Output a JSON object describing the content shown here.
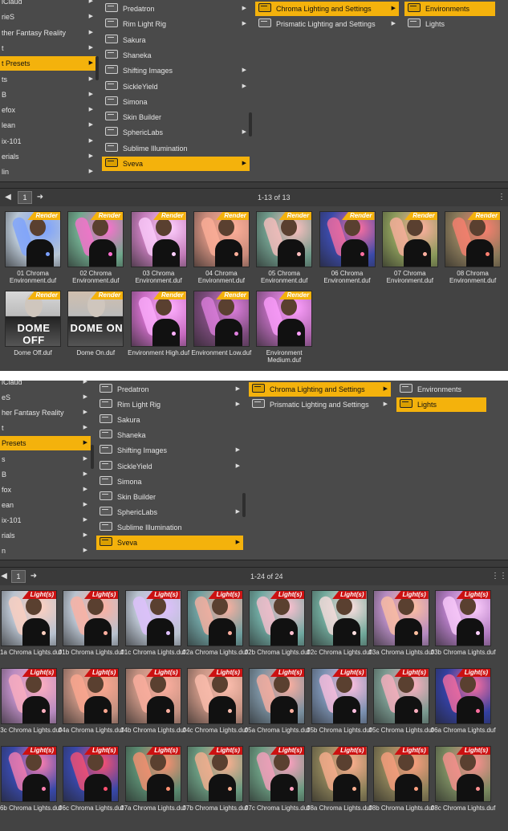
{
  "colors": {
    "accent": "#f4b20c",
    "render_badge": "#f4b20c",
    "light_badge": "#cc1111",
    "panel_bg": "#4a4a4a"
  },
  "top": {
    "col1": [
      "iClaud",
      "rieS",
      "ther Fantasy Reality",
      "t",
      "t Presets",
      "ts",
      "B",
      "efox",
      "lean",
      "ix-101",
      "erials",
      "lin"
    ],
    "col1_selected": 4,
    "col2": [
      {
        "label": "Predatron",
        "arrow": true
      },
      {
        "label": "Rim Light Rig",
        "arrow": true
      },
      {
        "label": "Sakura",
        "arrow": false
      },
      {
        "label": "Shaneka",
        "arrow": false
      },
      {
        "label": "Shifting Images",
        "arrow": true
      },
      {
        "label": "SickleYield",
        "arrow": true
      },
      {
        "label": "Simona",
        "arrow": false
      },
      {
        "label": "Skin Builder",
        "arrow": false
      },
      {
        "label": "SphericLabs",
        "arrow": true
      },
      {
        "label": "Sublime Illumination",
        "arrow": false
      },
      {
        "label": "Sveva",
        "arrow": true
      }
    ],
    "col2_selected": 10,
    "col3": [
      {
        "label": "Chroma Lighting and Settings",
        "arrow": true
      },
      {
        "label": "Prismatic Lighting and Settings",
        "arrow": true
      }
    ],
    "col3_selected": 0,
    "col4": [
      "Environments",
      "Lights"
    ],
    "col4_selected": 0,
    "page_number": "1",
    "page_count": "1-13 of 13",
    "badge_label": "Render",
    "tiles": [
      {
        "label": "01 Chroma Environment.duf",
        "hue": "#b8c6d4",
        "light": "#7aa0ff"
      },
      {
        "label": "02 Chroma Environment.duf",
        "hue": "#6fa88c",
        "light": "#ff6fd0"
      },
      {
        "label": "03 Chroma Environment.duf",
        "hue": "#c27ab8",
        "light": "#ffd0ff"
      },
      {
        "label": "04 Chroma Environment.duf",
        "hue": "#c98a7a",
        "light": "#ffb09a"
      },
      {
        "label": "05 Chroma Environment.duf",
        "hue": "#6f9a8a",
        "light": "#ffc0c0"
      },
      {
        "label": "06 Chroma Environment.duf",
        "hue": "#3b4aa8",
        "light": "#ff6fa0"
      },
      {
        "label": "07 Chroma Environment.duf",
        "hue": "#8a9a5a",
        "light": "#ffb0a0"
      },
      {
        "label": "08 Chroma Environment.duf",
        "hue": "#8a7a5a",
        "light": "#ff8070"
      },
      {
        "label": "Dome Off.duf",
        "hue": "#d8d8d8",
        "light": "#ffffff",
        "dome": "DOME OFF"
      },
      {
        "label": "Dome On.duf",
        "hue": "#d0bfae",
        "light": "#ffffff",
        "dome": "DOME ON"
      },
      {
        "label": "Environment High.duf",
        "hue": "#c66ac0",
        "light": "#ffb0ff"
      },
      {
        "label": "Environment Low.duf",
        "hue": "#7a4a7a",
        "light": "#e080e0"
      },
      {
        "label": "Environment Medium.duf",
        "hue": "#b066b0",
        "light": "#ffa0ff"
      }
    ]
  },
  "bottom": {
    "col1": [
      "iClaud",
      "eS",
      "her Fantasy Reality",
      "t",
      "Presets",
      "s",
      "B",
      "fox",
      "ean",
      "ix-101",
      "rials",
      "n"
    ],
    "col1_selected": 4,
    "col2_selected": 10,
    "col3_selected": 0,
    "col4_selected": 1,
    "page_number": "1",
    "page_count": "1-24 of 24",
    "badge_label": "Light(s)",
    "tiles": [
      {
        "label": "01a Chroma Lights.duf",
        "hue": "#b8c2cf",
        "light": "#ffd0c0"
      },
      {
        "label": "01b Chroma Lights.duf",
        "hue": "#b8c2cf",
        "light": "#ffb0a0"
      },
      {
        "label": "01c Chroma Lights.duf",
        "hue": "#b8c2cf",
        "light": "#e0c0ff"
      },
      {
        "label": "02a Chroma Lights.duf",
        "hue": "#6fa0a0",
        "light": "#ffb0a0"
      },
      {
        "label": "02b Chroma Lights.duf",
        "hue": "#6fa8a0",
        "light": "#ffc0d0"
      },
      {
        "label": "02c Chroma Lights.duf",
        "hue": "#70a89a",
        "light": "#ffe0e0"
      },
      {
        "label": "03a Chroma Lights.duf",
        "hue": "#b48ac0",
        "light": "#ffc0a0"
      },
      {
        "label": "03b Chroma Lights.duf",
        "hue": "#b07ac0",
        "light": "#ffd0ff"
      },
      {
        "label": "03c Chroma Lights.duf",
        "hue": "#b88ac0",
        "light": "#ffb0c0"
      },
      {
        "label": "04a Chroma Lights.duf",
        "hue": "#c29080",
        "light": "#ffa890"
      },
      {
        "label": "04b Chroma Lights.duf",
        "hue": "#c29080",
        "light": "#ffb0a0"
      },
      {
        "label": "04c Chroma Lights.duf",
        "hue": "#c29080",
        "light": "#ffc0b0"
      },
      {
        "label": "05a Chroma Lights.duf",
        "hue": "#7a90a0",
        "light": "#ffb0a0"
      },
      {
        "label": "05b Chroma Lights.duf",
        "hue": "#7a90b0",
        "light": "#ffc0e0"
      },
      {
        "label": "05c Chroma Lights.duf",
        "hue": "#7a9a90",
        "light": "#ffb0c0"
      },
      {
        "label": "06a Chroma Lights.duf",
        "hue": "#3340a0",
        "light": "#ff6fa0"
      },
      {
        "label": "06b Chroma Lights.duf",
        "hue": "#3848a8",
        "light": "#ff80b0"
      },
      {
        "label": "06c Chroma Lights.duf",
        "hue": "#3848a8",
        "light": "#ff5070"
      },
      {
        "label": "07a Chroma Lights.duf",
        "hue": "#5a8a70",
        "light": "#ff9070"
      },
      {
        "label": "07b Chroma Lights.duf",
        "hue": "#6a9a80",
        "light": "#ffb090"
      },
      {
        "label": "07c Chroma Lights.duf",
        "hue": "#6a9a80",
        "light": "#ffa0c0"
      },
      {
        "label": "08a Chroma Lights.duf",
        "hue": "#8a8058",
        "light": "#ffb090"
      },
      {
        "label": "08b Chroma Lights.duf",
        "hue": "#8a8058",
        "light": "#ffa080"
      },
      {
        "label": "08c Chroma Lights.duf",
        "hue": "#7a8a60",
        "light": "#ff9090"
      }
    ]
  }
}
